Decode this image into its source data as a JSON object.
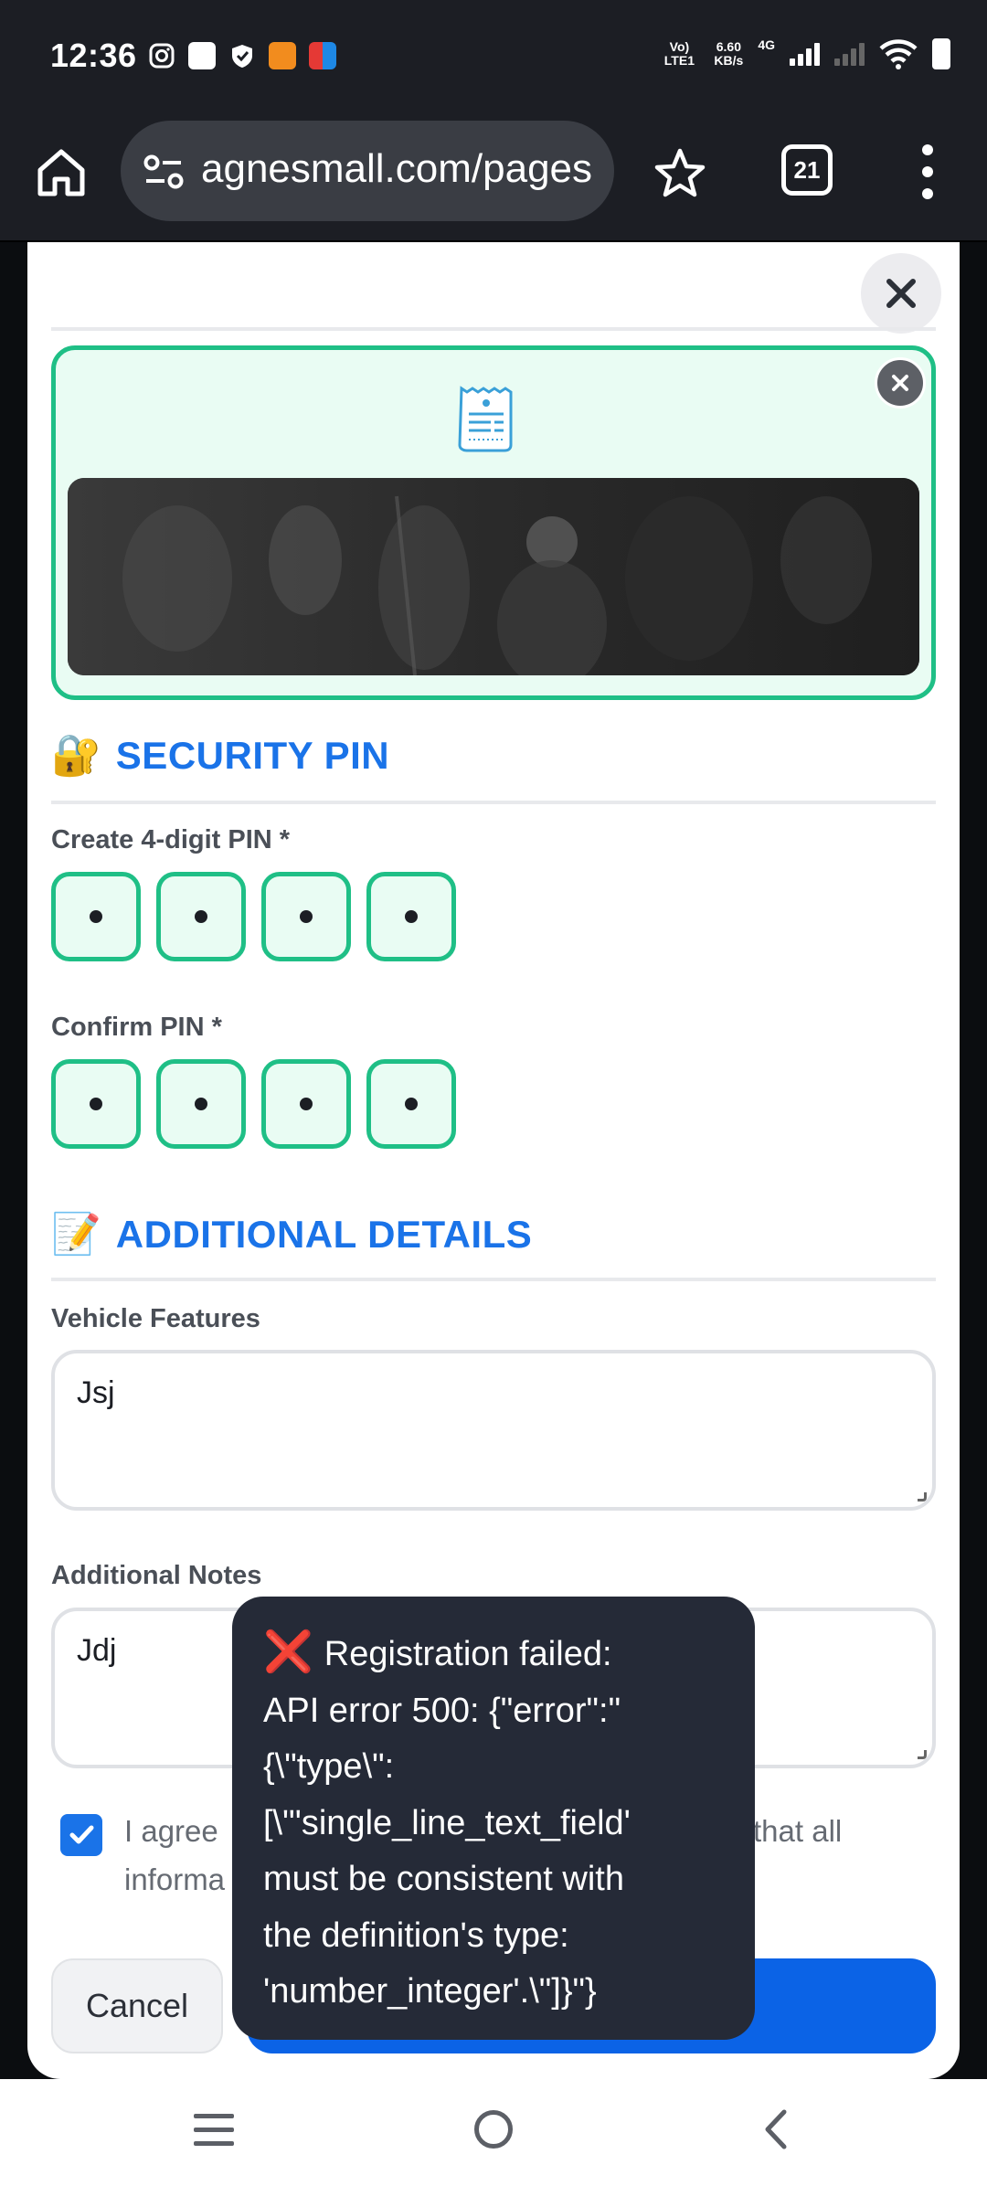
{
  "status_bar": {
    "time": "12:36",
    "volte": "Vo) LTE1",
    "speed_value": "6.60",
    "speed_unit": "KB/s",
    "network": "4G"
  },
  "browser": {
    "url": "agnesmall.com/pages",
    "tab_count": "21"
  },
  "security": {
    "emoji": "🔐",
    "title": "SECURITY PIN",
    "create_label": "Create 4-digit PIN *",
    "confirm_label": "Confirm PIN *"
  },
  "additional": {
    "emoji": "📝",
    "title": "ADDITIONAL DETAILS",
    "vehicle_label": "Vehicle Features",
    "vehicle_value": "Jsj",
    "notes_label": "Additional Notes",
    "notes_value": "Jdj"
  },
  "agreement": {
    "text_line1": "I agree",
    "text_line1_end": "that all",
    "text_line2": "informa"
  },
  "buttons": {
    "cancel": "Cancel"
  },
  "toast": {
    "icon": "❌",
    "lines": [
      "Registration failed:",
      "API error 500: {\"error\":\"",
      "{\\\"type\\\":",
      "[\\\"'single_line_text_field'",
      "must be consistent with",
      "the definition's type:",
      "'number_integer'.\\\"]}\"}"
    ]
  },
  "colors": {
    "accent_blue": "#1a73e8",
    "pin_green": "#1fbf86",
    "toast_bg": "#252a37"
  }
}
